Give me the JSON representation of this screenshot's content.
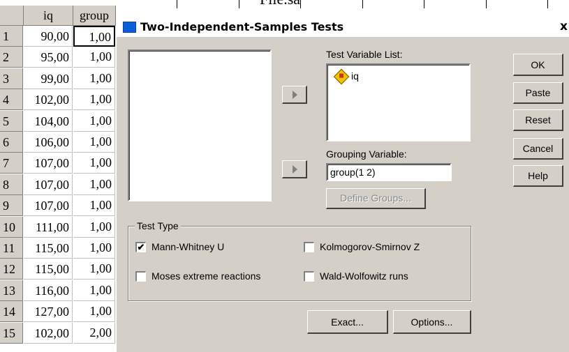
{
  "sheet": {
    "caption": "File.sa",
    "columns": [
      "iq",
      "group"
    ],
    "rows": [
      {
        "n": "1",
        "iq": "90,00",
        "group": "1,00"
      },
      {
        "n": "2",
        "iq": "95,00",
        "group": "1,00"
      },
      {
        "n": "3",
        "iq": "99,00",
        "group": "1,00"
      },
      {
        "n": "4",
        "iq": "102,00",
        "group": "1,00"
      },
      {
        "n": "5",
        "iq": "104,00",
        "group": "1,00"
      },
      {
        "n": "6",
        "iq": "106,00",
        "group": "1,00"
      },
      {
        "n": "7",
        "iq": "107,00",
        "group": "1,00"
      },
      {
        "n": "8",
        "iq": "107,00",
        "group": "1,00"
      },
      {
        "n": "9",
        "iq": "107,00",
        "group": "1,00"
      },
      {
        "n": "10",
        "iq": "111,00",
        "group": "1,00"
      },
      {
        "n": "11",
        "iq": "115,00",
        "group": "1,00"
      },
      {
        "n": "12",
        "iq": "115,00",
        "group": "1,00"
      },
      {
        "n": "13",
        "iq": "116,00",
        "group": "1,00"
      },
      {
        "n": "14",
        "iq": "127,00",
        "group": "1,00"
      },
      {
        "n": "15",
        "iq": "102,00",
        "group": "2,00"
      }
    ]
  },
  "dialog": {
    "title": "Two-Independent-Samples Tests",
    "close": "x",
    "test_variable_label": "Test Variable List:",
    "test_variables": [
      {
        "name": "iq",
        "icon": "scale-variable-icon"
      }
    ],
    "grouping_label": "Grouping Variable:",
    "grouping_value": "group(1 2)",
    "define_groups": "Define Groups...",
    "buttons": {
      "ok": "OK",
      "paste": "Paste",
      "reset": "Reset",
      "cancel": "Cancel",
      "help": "Help"
    },
    "test_type_label": "Test Type",
    "tests": [
      {
        "label": "Mann-Whitney U",
        "checked": true
      },
      {
        "label": "Kolmogorov-Smirnov Z",
        "checked": false
      },
      {
        "label": "Moses extreme reactions",
        "checked": false
      },
      {
        "label": "Wald-Wolfowitz runs",
        "checked": false
      }
    ],
    "exact": "Exact...",
    "options": "Options..."
  }
}
